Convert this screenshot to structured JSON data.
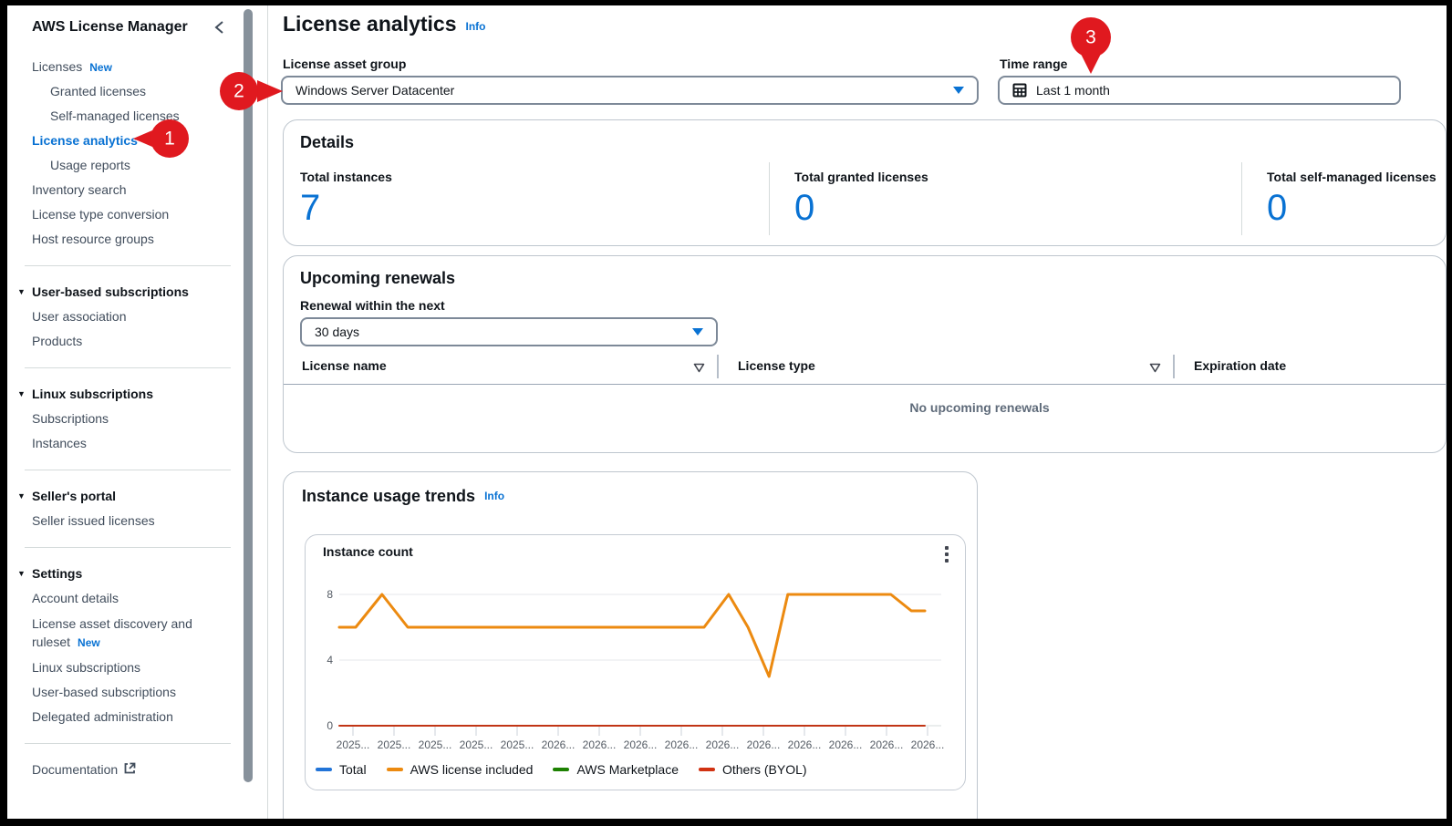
{
  "colors": {
    "accent": "#0972d3",
    "callout_red": "#e0191f",
    "big_number_blue": "#0972d3"
  },
  "sidebar": {
    "title": "AWS License Manager",
    "items": [
      {
        "type": "link",
        "label": "Licenses",
        "badge": "New"
      },
      {
        "type": "link",
        "label": "Granted licenses",
        "indent": true
      },
      {
        "type": "link",
        "label": "Self-managed licenses",
        "indent": true
      },
      {
        "type": "link",
        "label": "License analytics",
        "selected": true
      },
      {
        "type": "link",
        "label": "Usage reports",
        "indent": true
      },
      {
        "type": "link",
        "label": "Inventory search"
      },
      {
        "type": "link",
        "label": "License type conversion"
      },
      {
        "type": "link",
        "label": "Host resource groups"
      },
      {
        "type": "divider"
      },
      {
        "type": "section",
        "label": "User-based subscriptions"
      },
      {
        "type": "link",
        "label": "User association"
      },
      {
        "type": "link",
        "label": "Products"
      },
      {
        "type": "divider"
      },
      {
        "type": "section",
        "label": "Linux subscriptions"
      },
      {
        "type": "link",
        "label": "Subscriptions"
      },
      {
        "type": "link",
        "label": "Instances"
      },
      {
        "type": "divider"
      },
      {
        "type": "section",
        "label": "Seller's portal"
      },
      {
        "type": "link",
        "label": "Seller issued licenses"
      },
      {
        "type": "divider"
      },
      {
        "type": "section",
        "label": "Settings"
      },
      {
        "type": "link",
        "label": "Account details"
      },
      {
        "type": "link",
        "label": "License asset discovery and ruleset",
        "badge": "New",
        "wrap": true
      },
      {
        "type": "link",
        "label": "Linux subscriptions"
      },
      {
        "type": "link",
        "label": "User-based subscriptions"
      },
      {
        "type": "link",
        "label": "Delegated administration"
      },
      {
        "type": "divider"
      },
      {
        "type": "link",
        "label": "Documentation",
        "external": true
      }
    ]
  },
  "header": {
    "title": "License analytics",
    "info_label": "Info"
  },
  "filters": {
    "asset_group_label": "License asset group",
    "asset_group_value": "Windows Server Datacenter",
    "time_range_label": "Time range",
    "time_range_value": "Last 1 month"
  },
  "details": {
    "title": "Details",
    "metrics": [
      {
        "label": "Total instances",
        "value": "7"
      },
      {
        "label": "Total granted licenses",
        "value": "0"
      },
      {
        "label": "Total self-managed licenses",
        "value": "0"
      }
    ]
  },
  "renewals": {
    "title": "Upcoming renewals",
    "filter_label": "Renewal within the next",
    "filter_value": "30 days",
    "columns": [
      "License name",
      "License type",
      "Expiration date"
    ],
    "empty_message": "No upcoming renewals"
  },
  "usage_trends": {
    "title": "Instance usage trends",
    "info_label": "Info"
  },
  "chart_data": {
    "type": "line",
    "title": "Instance count",
    "y_ticks": [
      0,
      4,
      8
    ],
    "ylim": [
      0,
      9
    ],
    "grid": true,
    "legend_position": "bottom",
    "x_tick_labels": [
      "2025...",
      "2025...",
      "2025...",
      "2025...",
      "2025...",
      "2026...",
      "2026...",
      "2026...",
      "2026...",
      "2026...",
      "2026...",
      "2026...",
      "2026...",
      "2026...",
      "2026..."
    ],
    "legend": [
      {
        "name": "Total",
        "color": "#2274d8"
      },
      {
        "name": "AWS license included",
        "color": "#ec8a10"
      },
      {
        "name": "AWS Marketplace",
        "color": "#1d8102"
      },
      {
        "name": "Others (BYOL)",
        "color": "#d13212"
      }
    ],
    "series": [
      {
        "name": "AWS license included",
        "color": "#ec8a10",
        "width": 3,
        "points": [
          [
            0,
            6
          ],
          [
            0.028,
            6
          ],
          [
            0.073,
            8
          ],
          [
            0.117,
            6
          ],
          [
            0.623,
            6
          ],
          [
            0.665,
            8
          ],
          [
            0.698,
            6
          ],
          [
            0.734,
            3
          ],
          [
            0.766,
            8
          ],
          [
            0.942,
            8
          ],
          [
            0.977,
            7
          ],
          [
            1,
            7
          ]
        ]
      },
      {
        "name": "Others (BYOL)",
        "color": "#c13515",
        "width": 2,
        "points": [
          [
            0,
            0
          ],
          [
            1,
            0
          ]
        ]
      }
    ],
    "values_at_ticks_aws_license_included": [
      6,
      8,
      6,
      6,
      6,
      6,
      6,
      6,
      6,
      6,
      8,
      3,
      8,
      8,
      7
    ]
  },
  "callouts": {
    "items": [
      {
        "label": "1"
      },
      {
        "label": "2"
      },
      {
        "label": "3"
      }
    ]
  }
}
